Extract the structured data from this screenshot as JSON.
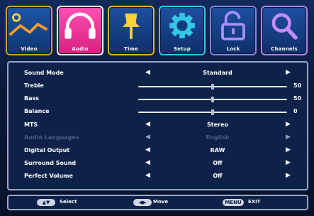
{
  "tabs": [
    {
      "label": "Video",
      "icon": "video-curve-icon"
    },
    {
      "label": "Audio",
      "icon": "headphones-icon"
    },
    {
      "label": "Time",
      "icon": "pin-icon"
    },
    {
      "label": "Setup",
      "icon": "gear-icon"
    },
    {
      "label": "Lock",
      "icon": "unlocked-padlock-icon"
    },
    {
      "label": "Channels",
      "icon": "magnifier-icon"
    }
  ],
  "active_tab": "Audio",
  "settings": {
    "sound_mode": {
      "label": "Sound Mode",
      "value": "Standard"
    },
    "treble": {
      "label": "Treble",
      "value": "50",
      "level": 0.5
    },
    "bass": {
      "label": "Bass",
      "value": "50",
      "level": 0.5
    },
    "balance": {
      "label": "Balance",
      "value": "0",
      "level": 0.5
    },
    "mts": {
      "label": "MTS",
      "value": "Stereo"
    },
    "audio_languages": {
      "label": "Audio Languages",
      "value": "English"
    },
    "digital_output": {
      "label": "Digital Output",
      "value": "RAW"
    },
    "surround_sound": {
      "label": "Surround Sound",
      "value": "Off"
    },
    "perfect_volume": {
      "label": "Perfect Volume",
      "value": "Off"
    }
  },
  "footer": {
    "select_label": "Select",
    "move_label": "Move",
    "menu_key": "MENU",
    "exit_label": "EXIT"
  },
  "colors": {
    "active_tab": "#e0308f",
    "panel_bg": "#0d2149",
    "text": "#ffffff"
  }
}
